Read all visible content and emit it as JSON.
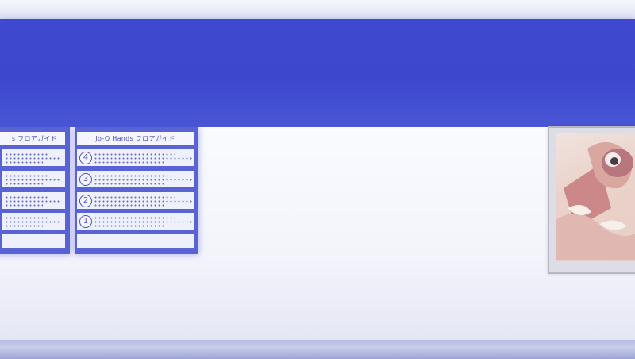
{
  "directories": [
    {
      "title": "s フロアガイド",
      "floors": [
        {
          "num": ""
        },
        {
          "num": ""
        },
        {
          "num": ""
        },
        {
          "num": ""
        }
      ]
    },
    {
      "title": "Jo-Q Hands フロアガイド",
      "floors": [
        {
          "num": "4"
        },
        {
          "num": "3"
        },
        {
          "num": "2"
        },
        {
          "num": "1"
        }
      ]
    }
  ],
  "colors": {
    "banner": "#3f49cf",
    "directory_board": "#5a63d3",
    "directory_text": "#4a52c4",
    "wall": "#f3f4fb"
  },
  "poster": {
    "icon": "abstract-character-poster-icon"
  }
}
